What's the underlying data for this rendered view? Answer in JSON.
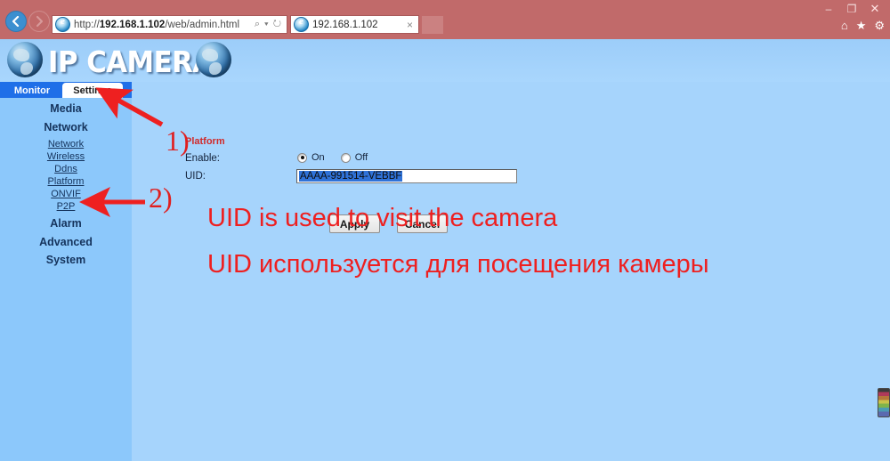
{
  "browser": {
    "back_icon": "back-arrow-icon",
    "forward_icon": "forward-arrow-icon",
    "url_prefix": "http://",
    "url_host": "192.168.1.102",
    "url_path": "/web/admin.html",
    "address_icons": "⌕ ▾  ↻",
    "tab_title": "192.168.1.102",
    "tab_close": "×",
    "window_controls": {
      "minimize": "–",
      "restore": "❐",
      "close": "✕"
    },
    "toolbar_icons": {
      "home": "⌂",
      "favorites": "★",
      "settings": "⚙"
    }
  },
  "header": {
    "brand": "IP CAMERA",
    "globe_left": "globe-icon",
    "globe_right": "globe-icon"
  },
  "tabs": [
    {
      "label": "Monitor",
      "active": false
    },
    {
      "label": "Settings",
      "active": true
    }
  ],
  "sidebar": {
    "groups": [
      {
        "label": "Media",
        "type": "group"
      },
      {
        "label": "Network",
        "type": "group"
      },
      {
        "label": "Network",
        "type": "link"
      },
      {
        "label": "Wireless",
        "type": "link"
      },
      {
        "label": "Ddns",
        "type": "link"
      },
      {
        "label": "Platform",
        "type": "link"
      },
      {
        "label": "ONVIF",
        "type": "link"
      },
      {
        "label": "P2P",
        "type": "link"
      },
      {
        "label": "Alarm",
        "type": "group"
      },
      {
        "label": "Advanced",
        "type": "group"
      },
      {
        "label": "System",
        "type": "group"
      }
    ]
  },
  "form": {
    "title": "Platform",
    "enable_label": "Enable:",
    "radio_on_label": "On",
    "radio_off_label": "Off",
    "enable_value": "On",
    "uid_label": "UID:",
    "uid_value": "AAAA-991514-VEBBF",
    "apply_label": "Apply",
    "cancel_label": "Cancel"
  },
  "annotations": {
    "marker_1": "1)",
    "marker_2": "2)",
    "text_en": "UID is used to visit the camera",
    "text_ru": "UID используется для посещения камеры",
    "color": "#ee2020"
  },
  "colors": {
    "chrome": "#c16a6a",
    "sidebar": "#8cc8fb",
    "content": "#a6d4fc",
    "tab_bar": "#1f6fe8",
    "title_red": "#d02a2a",
    "selection_blue": "#2f72d8"
  }
}
